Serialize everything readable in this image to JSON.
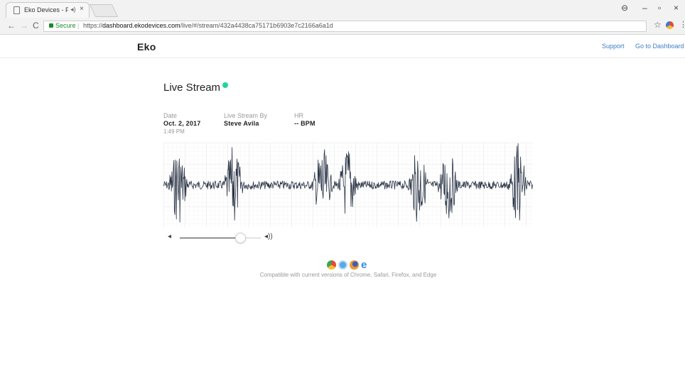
{
  "browser": {
    "tab_title": "Eko Devices - Patient",
    "tab_audio_icon": "speaker-icon",
    "tab_close": "×",
    "win_controls": {
      "account": "⊖",
      "minimize": "–",
      "restore": "▫",
      "close": "×"
    },
    "nav": {
      "back": "←",
      "forward": "→",
      "reload": "C"
    },
    "secure_label": "Secure",
    "url_prefix": "https://",
    "url_host": "dashboard.ekodevices.com",
    "url_path": "/live/#/stream/432a4438ca75171b6903e7c2166a6a1d",
    "star": "☆",
    "menu": "⋮"
  },
  "header": {
    "brand": "Eko",
    "links": {
      "support": "Support",
      "dashboard": "Go to Dashboard"
    },
    "link_color": "#3b7ec9"
  },
  "stream": {
    "title": "Live Stream",
    "live_indicator_color": "#1fd4a0",
    "date_label": "Date",
    "date_value": "Oct. 2, 2017",
    "time_value": "1:49 PM",
    "by_label": "Live Stream By",
    "by_value": "Steve Avila",
    "hr_label": "HR",
    "hr_value": "-- BPM"
  },
  "waveform": {
    "description_icon": "waveform-display",
    "burst_times": [
      0.04,
      0.19,
      0.43,
      0.5,
      0.69,
      0.77,
      0.96
    ]
  },
  "volume": {
    "mute_icon": "◂",
    "loud_icon": "◂))",
    "level": 0.72
  },
  "compatibility": {
    "text": "Compatible with current versions of Chrome, Safari, Firefox, and Edge",
    "icons": [
      "chrome-icon",
      "safari-icon",
      "firefox-icon",
      "edge-icon"
    ]
  }
}
